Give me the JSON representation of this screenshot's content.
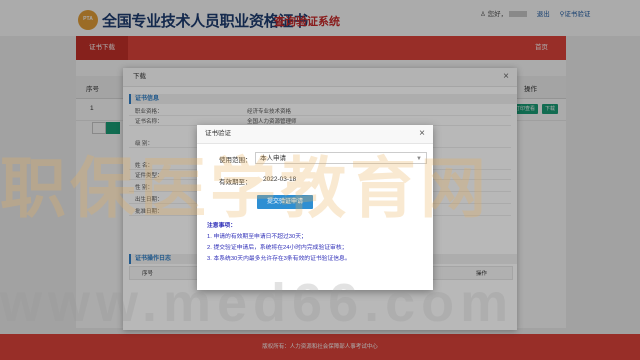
{
  "header": {
    "logo_text": "PTA",
    "title": "全国专业技术人员职业资格证书",
    "subtitle": "查询验证系统",
    "greeting": "您好，",
    "exit_link": "退出",
    "verify_link": "证书验证"
  },
  "nav": {
    "active_tab": "证书下载",
    "right_link": "首页"
  },
  "content": {
    "columns": [
      "序号",
      "操作"
    ],
    "row_index": "1",
    "row_buttons": [
      "打印查看",
      "下载"
    ]
  },
  "dialog_download": {
    "title": "下载",
    "close": "×",
    "section_info": "证书信息",
    "fields": [
      {
        "label": "职业资格：",
        "value": "经济专业技术资格"
      },
      {
        "label": "证书名称：",
        "value": "全国人力资源管理师"
      },
      {
        "label": "级    别：",
        "value": ""
      },
      {
        "label": "姓    名：",
        "value": ""
      },
      {
        "label": "证件类型：",
        "value": ""
      },
      {
        "label": "性    别：",
        "value": ""
      },
      {
        "label": "出生日期：",
        "value": ""
      },
      {
        "label": "批准日期：",
        "value": ""
      }
    ],
    "section_log": "证书操作日志",
    "log_columns": [
      "序号",
      "操作"
    ]
  },
  "dialog_verify": {
    "title": "证书验证",
    "close": "×",
    "scope_label": "使用范围：",
    "scope_value": "本人申请",
    "validity_label": "有效期至：",
    "validity_value": "2022-03-18",
    "submit_label": "提交验证申请",
    "notes_title": "注意事项：",
    "notes": [
      "1. 申请的有效期至申请日不超过30天；",
      "2. 提交验证申请后，系统将在24小时内完成验证审核；",
      "3. 本系统30天内最多允许存在3条有效的证书验证信息。"
    ]
  },
  "footer": {
    "text": "版权所有：人力资源和社会保障部人事考试中心"
  },
  "watermark": {
    "big": "职保医学教育网",
    "url": "www.med66.com"
  },
  "colors": {
    "brand_red": "#e3453c",
    "title_navy": "#1e3e73",
    "accent_green": "#1aa179",
    "button_blue": "#2e8fd3",
    "note_blue": "#2e2eb8"
  }
}
